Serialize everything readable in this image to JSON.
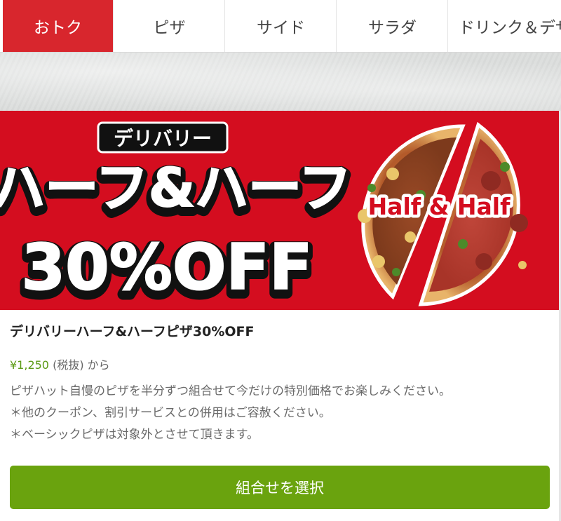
{
  "tabs": [
    {
      "label": "おトク"
    },
    {
      "label": "ピザ"
    },
    {
      "label": "サイド"
    },
    {
      "label": "サラダ"
    },
    {
      "label": "ドリンク＆デザ"
    }
  ],
  "banner": {
    "tag": "デリバリー",
    "headline": "ハーフ&ハーフ",
    "discount": "30%OFF",
    "pizza_label": "Half & Half",
    "colors": {
      "background": "#d40d1f"
    }
  },
  "coupon": {
    "title": "デリバリーハーフ&ハーフピザ30%OFF",
    "price": "¥1,250",
    "tax_note": "(税抜)",
    "price_suffix": "から",
    "description": [
      "ピザハット自慢のピザを半分ずつ組合せて今だけの特別価格でお楽しみください。",
      "＊他のクーポン、割引サービスとの併用はご容赦ください。",
      "＊ベーシックピザは対象外とさせて頂きます。"
    ],
    "button_label": "組合せを選択"
  },
  "colors": {
    "accent_red": "#d8262d",
    "price_green": "#5c9b16",
    "button_green": "#6aa30e"
  }
}
